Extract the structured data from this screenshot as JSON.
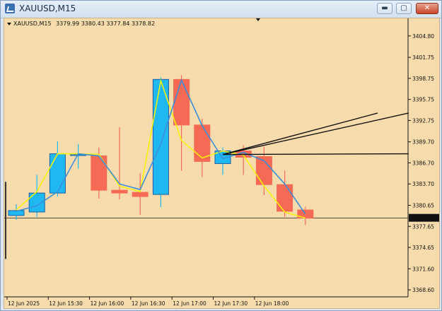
{
  "window": {
    "title": "XAUUSD,M15",
    "minimize_label": "▬",
    "maximize_label": "▢",
    "close_label": "✕"
  },
  "chart_info": {
    "symbol": "XAUUSD,M15",
    "ohlc": "3379.99 3380.43 3377.84 3378.82"
  },
  "chart_data": {
    "type": "candlestick",
    "symbol": "XAUUSD",
    "timeframe": "M15",
    "ylim": [
      3367.6,
      3407.3
    ],
    "y_ticks": [
      "3404.80",
      "3401.75",
      "3398.75",
      "3395.75",
      "3392.75",
      "3389.70",
      "3386.70",
      "3383.70",
      "3380.65",
      "3377.65",
      "3374.65",
      "3371.60",
      "3368.60"
    ],
    "x_ticks": [
      "12 Jun 2025",
      "12 Jun 15:30",
      "12 Jun 16:00",
      "12 Jun 16:30",
      "12 Jun 17:00",
      "12 Jun 17:30",
      "12 Jun 18:00"
    ],
    "current_price": "3378.82",
    "bull_color": "#1fb8f0",
    "bear_color": "#f46a55",
    "candles": [
      {
        "o": 3379.2,
        "h": 3380.8,
        "l": 3378.6,
        "c": 3379.9
      },
      {
        "o": 3379.7,
        "h": 3385.0,
        "l": 3379.0,
        "c": 3382.4
      },
      {
        "o": 3382.4,
        "h": 3389.8,
        "l": 3381.9,
        "c": 3388.0
      },
      {
        "o": 3387.9,
        "h": 3389.4,
        "l": 3385.9,
        "c": 3387.9
      },
      {
        "o": 3387.7,
        "h": 3388.9,
        "l": 3381.6,
        "c": 3382.8
      },
      {
        "o": 3382.8,
        "h": 3391.8,
        "l": 3381.5,
        "c": 3382.4
      },
      {
        "o": 3382.5,
        "h": 3385.2,
        "l": 3379.3,
        "c": 3381.9
      },
      {
        "o": 3382.2,
        "h": 3398.9,
        "l": 3380.4,
        "c": 3398.6
      },
      {
        "o": 3398.6,
        "h": 3399.2,
        "l": 3385.6,
        "c": 3392.1
      },
      {
        "o": 3392.1,
        "h": 3393.0,
        "l": 3384.7,
        "c": 3386.9
      },
      {
        "o": 3386.6,
        "h": 3388.9,
        "l": 3385.0,
        "c": 3388.4
      },
      {
        "o": 3388.4,
        "h": 3389.2,
        "l": 3385.0,
        "c": 3387.5
      },
      {
        "o": 3387.6,
        "h": 3389.0,
        "l": 3382.1,
        "c": 3383.6
      },
      {
        "o": 3383.6,
        "h": 3385.6,
        "l": 3379.0,
        "c": 3379.8
      },
      {
        "o": 3379.99,
        "h": 3380.43,
        "l": 3377.84,
        "c": 3378.82
      }
    ],
    "ma_yellow": [
      3380.0,
      3382.6,
      3388.0,
      3388.0,
      3387.9,
      3383.4,
      3382.6,
      3398.4,
      3389.9,
      3387.4,
      3388.4,
      3387.8,
      3383.4,
      3379.7,
      3378.82
    ],
    "ma_blue": [
      3379.8,
      3380.6,
      3382.6,
      3388.0,
      3387.7,
      3383.7,
      3382.9,
      3389.4,
      3398.5,
      3392.0,
      3387.3,
      3388.2,
      3387.0,
      3383.7,
      3379.4
    ],
    "trend_lines": [
      {
        "p1": [
          10,
          3387.9
        ],
        "p2": [
          19,
          3393.8
        ]
      },
      {
        "p1": [
          10,
          3387.9
        ],
        "p2": [
          19,
          3388.0
        ]
      },
      {
        "p1": [
          10,
          3387.9
        ],
        "p2": [
          17.5,
          3393.8
        ]
      }
    ]
  }
}
